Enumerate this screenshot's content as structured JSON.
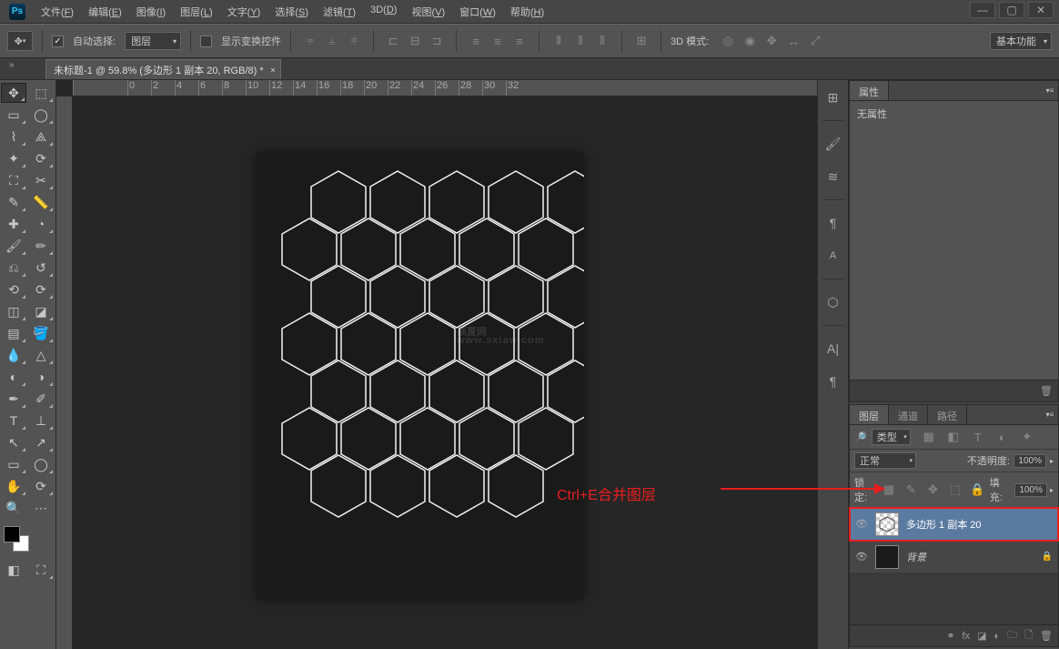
{
  "app": {
    "logo": "Ps"
  },
  "menu": {
    "items": [
      {
        "text": "文件",
        "accel": "F"
      },
      {
        "text": "编辑",
        "accel": "E"
      },
      {
        "text": "图像",
        "accel": "I"
      },
      {
        "text": "图层",
        "accel": "L"
      },
      {
        "text": "文字",
        "accel": "Y"
      },
      {
        "text": "选择",
        "accel": "S"
      },
      {
        "text": "滤镜",
        "accel": "T"
      },
      {
        "text": "3D",
        "accel": "D"
      },
      {
        "text": "视图",
        "accel": "V"
      },
      {
        "text": "窗口",
        "accel": "W"
      },
      {
        "text": "帮助",
        "accel": "H"
      }
    ]
  },
  "options": {
    "auto_select_label": "自动选择:",
    "auto_select_target": "图层",
    "show_transform_label": "显示变换控件",
    "mode3d_label": "3D 模式:",
    "workspace": "基本功能"
  },
  "document": {
    "tab_title": "未标题-1 @ 59.8% (多边形 1 副本 20, RGB/8) *",
    "tab_expand": "»"
  },
  "ruler": {
    "h_ticks": [
      "0",
      "2",
      "4",
      "6",
      "8",
      "10",
      "12",
      "14",
      "16",
      "18",
      "20",
      "22",
      "24",
      "26",
      "28",
      "30",
      "32"
    ]
  },
  "properties_panel": {
    "tab": "属性",
    "no_props": "无属性"
  },
  "layers_panel": {
    "tabs": {
      "layers": "图层",
      "channels": "通道",
      "paths": "路径"
    },
    "kind_label": "类型",
    "blend_mode": "正常",
    "opacity_label": "不透明度:",
    "opacity_value": "100%",
    "lock_label": "锁定:",
    "fill_label": "填充:",
    "fill_value": "100%",
    "layers": [
      {
        "name": "多边形 1 副本 20",
        "visible": true,
        "selected": true,
        "locked": false,
        "thumb": "checker"
      },
      {
        "name": "背景",
        "visible": true,
        "selected": false,
        "locked": true,
        "thumb": "dark"
      }
    ],
    "filter_icons": [
      "▦",
      "T",
      "◧",
      "◐",
      "✦"
    ]
  },
  "watermark": {
    "main": "硕夏网",
    "sub": "www.sxiaw.com"
  },
  "annotation": {
    "text": "Ctrl+E合并图层"
  },
  "window_controls": {
    "min": "—",
    "max": "▢",
    "close": "✕"
  },
  "lock_icons": [
    "▦",
    "✎",
    "✥",
    "⬚",
    "🔒"
  ]
}
